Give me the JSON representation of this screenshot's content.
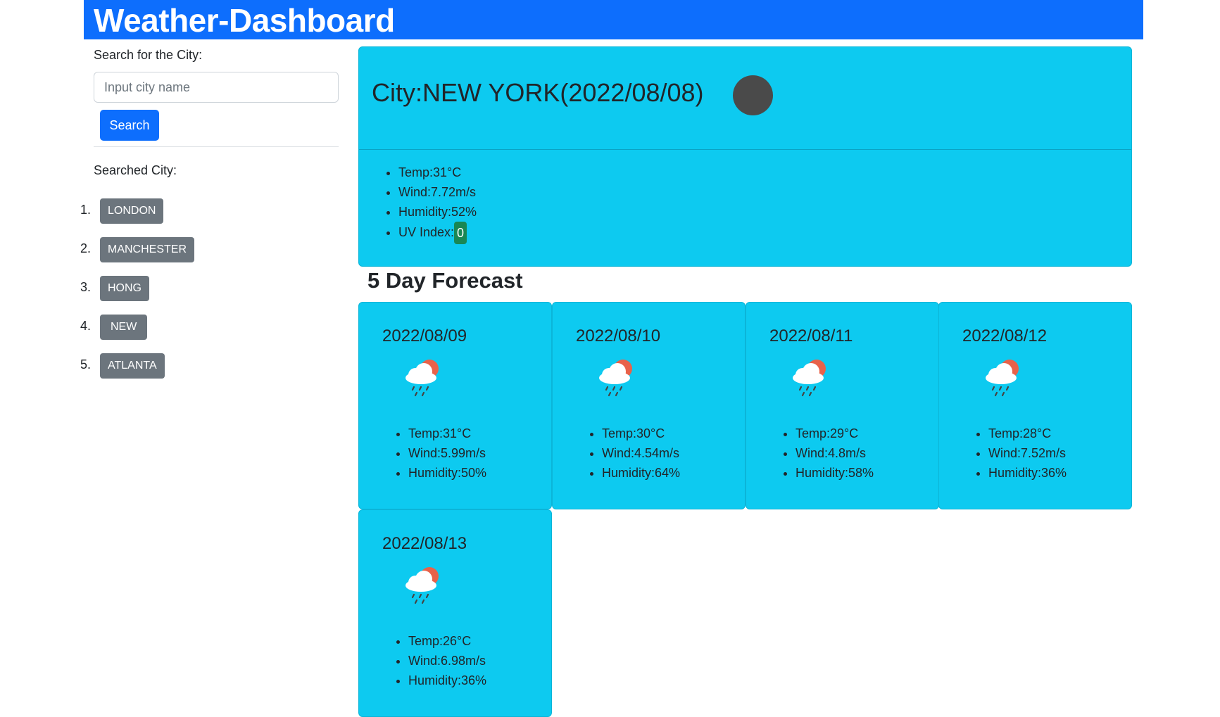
{
  "header": {
    "title": "Weather-Dashboard"
  },
  "search": {
    "label": "Search for the City:",
    "placeholder": "Input city name",
    "value": "",
    "button_label": "Search"
  },
  "history": {
    "label": "Searched City:",
    "cities": [
      {
        "num": "1.",
        "name": "LONDON"
      },
      {
        "num": "2.",
        "name": "MANCHESTER"
      },
      {
        "num": "3.",
        "name": "HONG KONG"
      },
      {
        "num": "4.",
        "name": "NEW YORK"
      },
      {
        "num": "5.",
        "name": "ATLANTA"
      }
    ]
  },
  "current": {
    "title": "City:NEW YORK(2022/08/08)",
    "icon": "weather-icon-placeholder",
    "temp": "Temp:31°C",
    "wind": "Wind:7.72m/s",
    "humidity": "Humidity:52%",
    "uv_label": "UV Index:",
    "uv_value": "0"
  },
  "forecast": {
    "title": "5 Day Forecast",
    "icon": "rain-cloud-sun-icon",
    "days": [
      {
        "date": "2022/08/09",
        "temp": "Temp:31°C",
        "wind": "Wind:5.99m/s",
        "humidity": "Humidity:50%"
      },
      {
        "date": "2022/08/10",
        "temp": "Temp:30°C",
        "wind": "Wind:4.54m/s",
        "humidity": "Humidity:64%"
      },
      {
        "date": "2022/08/11",
        "temp": "Temp:29°C",
        "wind": "Wind:4.8m/s",
        "humidity": "Humidity:58%"
      },
      {
        "date": "2022/08/12",
        "temp": "Temp:28°C",
        "wind": "Wind:7.52m/s",
        "humidity": "Humidity:36%"
      },
      {
        "date": "2022/08/13",
        "temp": "Temp:26°C",
        "wind": "Wind:6.98m/s",
        "humidity": "Humidity:36%"
      }
    ]
  },
  "colors": {
    "header": "#0d6efd",
    "card": "#0dcaf0",
    "history_button": "#6c757d",
    "uv_badge": "#198754"
  }
}
